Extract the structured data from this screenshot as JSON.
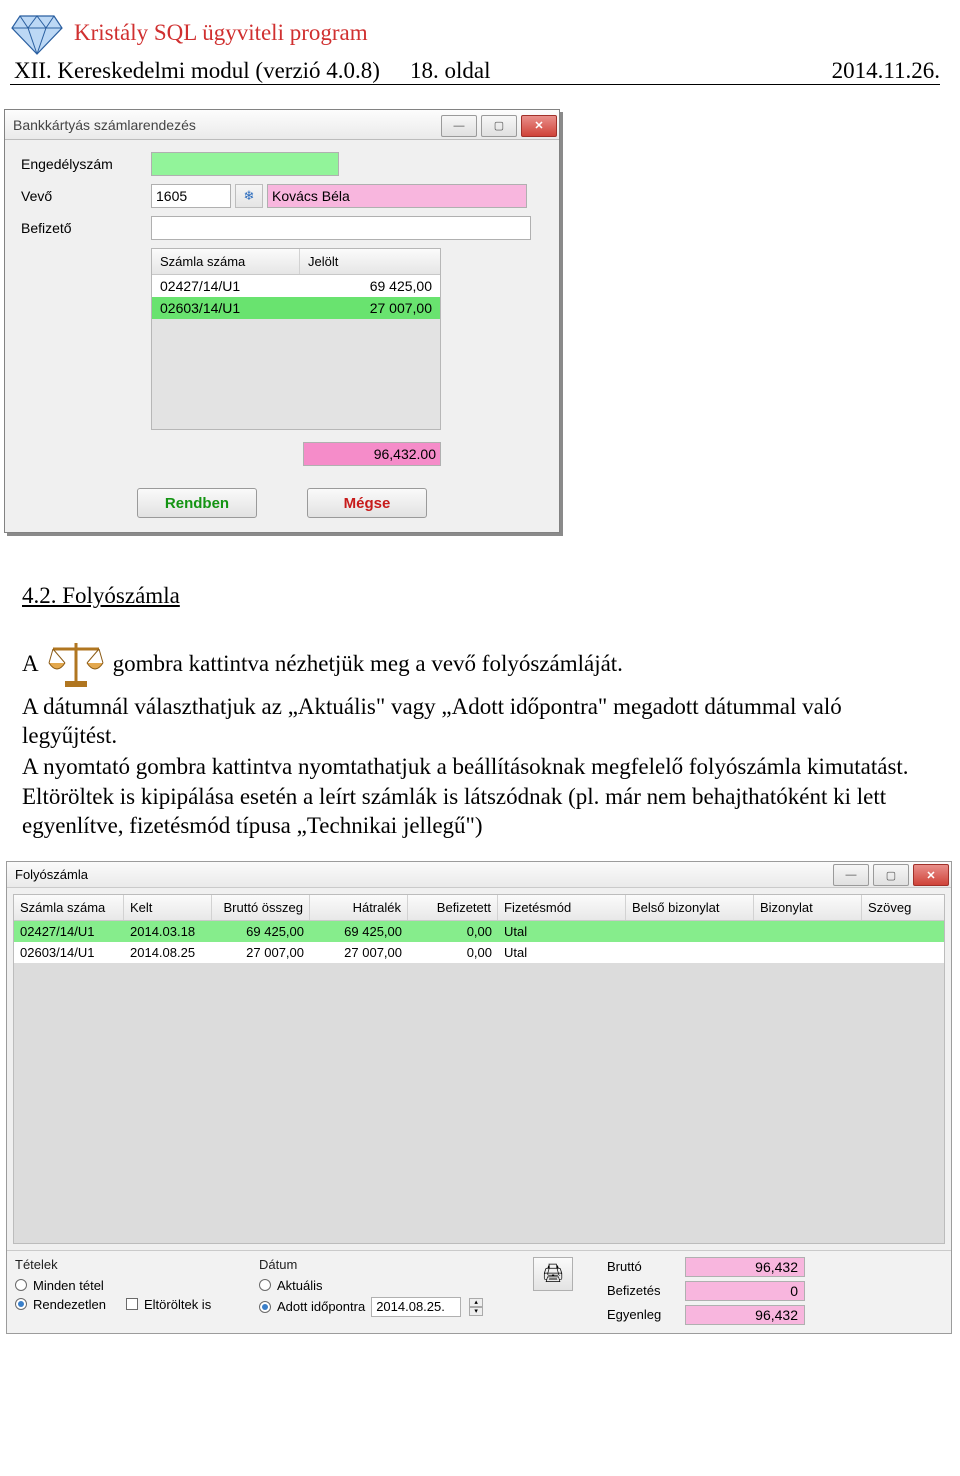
{
  "header": {
    "program_title": "Kristály SQL ügyviteli program",
    "module_line": "XII. Kereskedelmi modul (verzió 4.0.8)",
    "page_label": "18. oldal",
    "date": "2014.11.26."
  },
  "dialog1": {
    "title": "Bankkártyás számlarendezés",
    "labels": {
      "auth": "Engedélyszám",
      "vevo": "Vevő",
      "befizeto": "Befizető"
    },
    "vevo_number": "1605",
    "vevo_name": "Kovács Béla",
    "grid_headers": {
      "szamla": "Számla száma",
      "jelolt": "Jelölt"
    },
    "grid_rows": [
      {
        "szamla": "02427/14/U1",
        "jelolt": "69 425,00"
      },
      {
        "szamla": "02603/14/U1",
        "jelolt": "27 007,00"
      }
    ],
    "total": "96,432.00",
    "ok": "Rendben",
    "cancel": "Mégse"
  },
  "section": {
    "heading": "4.2.    Folyószámla",
    "para1_before": "A",
    "para1_after": "gombra kattintva nézhetjük meg a vevő folyószámláját.",
    "para2": "A dátumnál választhatjuk az „Aktuális\" vagy „Adott időpontra\" megadott dátummal való legyűjtést.",
    "para3": "A nyomtató gombra kattintva nyomtathatjuk a beállításoknak megfelelő folyószámla kimutatást.",
    "para4": "Eltöröltek is kipipálása esetén a leírt számlák is látszódnak (pl. már nem behajthatóként ki lett egyenlítve, fizetésmód típusa „Technikai jellegű\")"
  },
  "dialog2": {
    "title": "Folyószámla",
    "headers": {
      "szamla": "Számla száma",
      "kelt": "Kelt",
      "brutto": "Bruttó összeg",
      "hatralek": "Hátralék",
      "befizetett": "Befizetett",
      "fizmod": "Fizetésmód",
      "belso": "Belső bizonylat",
      "bizonylat": "Bizonylat",
      "szoveg": "Szöveg"
    },
    "rows": [
      {
        "szamla": "02427/14/U1",
        "kelt": "2014.03.18",
        "brutto": "69 425,00",
        "hatralek": "69 425,00",
        "befizetett": "0,00",
        "fizmod": "Utal"
      },
      {
        "szamla": "02603/14/U1",
        "kelt": "2014.08.25",
        "brutto": "27 007,00",
        "hatralek": "27 007,00",
        "befizetett": "0,00",
        "fizmod": "Utal"
      }
    ],
    "footer": {
      "tetelek": "Tételek",
      "minden": "Minden tétel",
      "rendezetlen": "Rendezetlen",
      "eltoroltek": "Eltöröltek is",
      "datum": "Dátum",
      "aktualis": "Aktuális",
      "adott": "Adott időpontra",
      "adott_value": "2014.08.25.",
      "brutto_label": "Bruttó",
      "brutto_val": "96,432",
      "befizetes_label": "Befizetés",
      "befizetes_val": "0",
      "egyenleg_label": "Egyenleg",
      "egyenleg_val": "96,432"
    }
  }
}
